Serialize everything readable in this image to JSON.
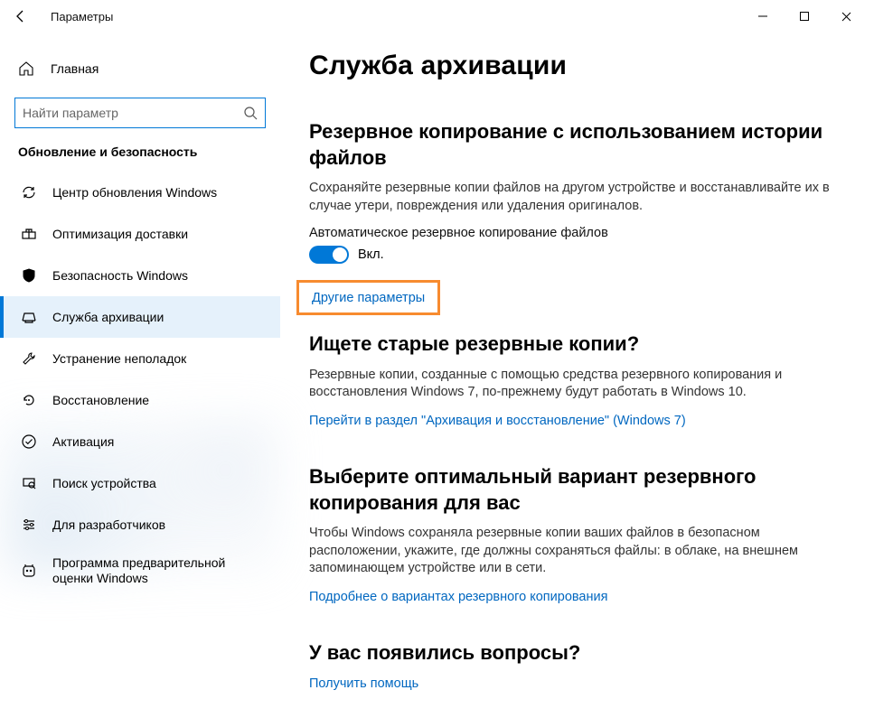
{
  "window": {
    "title": "Параметры"
  },
  "sidebar": {
    "home": "Главная",
    "search_placeholder": "Найти параметр",
    "category": "Обновление и безопасность",
    "items": [
      {
        "label": "Центр обновления Windows"
      },
      {
        "label": "Оптимизация доставки"
      },
      {
        "label": "Безопасность Windows"
      },
      {
        "label": "Служба архивации"
      },
      {
        "label": "Устранение неполадок"
      },
      {
        "label": "Восстановление"
      },
      {
        "label": "Активация"
      },
      {
        "label": "Поиск устройства"
      },
      {
        "label": "Для разработчиков"
      },
      {
        "label": "Программа предварительной оценки Windows"
      }
    ]
  },
  "main": {
    "page_title": "Служба архивации",
    "section1": {
      "heading": "Резервное копирование с использованием истории файлов",
      "desc": "Сохраняйте резервные копии файлов на другом устройстве и восстанавливайте их в случае утери, повреждения или удаления оригиналов.",
      "toggle_label": "Автоматическое резервное копирование файлов",
      "toggle_state": "Вкл.",
      "more_link": "Другие параметры"
    },
    "section2": {
      "heading": "Ищете старые резервные копии?",
      "desc": "Резервные копии, созданные с помощью средства резервного копирования и восстановления Windows 7, по-прежнему будут работать в Windows 10.",
      "link": "Перейти в раздел \"Архивация и восстановление\" (Windows 7)"
    },
    "section3": {
      "heading": "Выберите оптимальный вариант резервного копирования для вас",
      "desc": "Чтобы Windows сохраняла резервные копии ваших файлов в безопасном расположении, укажите, где должны сохраняться файлы: в облаке, на внешнем запоминающем устройстве или в сети.",
      "link": "Подробнее о вариантах резервного копирования"
    },
    "section4": {
      "heading": "У вас появились вопросы?",
      "link": "Получить помощь"
    }
  }
}
